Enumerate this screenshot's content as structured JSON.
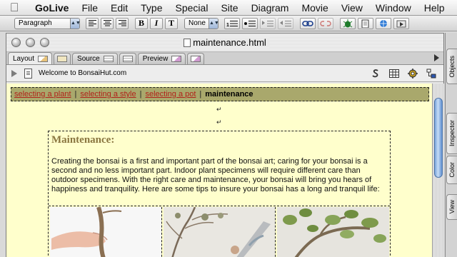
{
  "menubar": {
    "items": [
      "GoLive",
      "File",
      "Edit",
      "Type",
      "Special",
      "Site",
      "Diagram",
      "Movie",
      "View",
      "Window",
      "Help"
    ]
  },
  "toolbar": {
    "paragraph_format": "Paragraph",
    "font_size": "None",
    "bold_label": "B",
    "italic_label": "I",
    "teletype_label": "T"
  },
  "document": {
    "filename": "maintenance.html",
    "tabs": [
      "Layout",
      "Source",
      "Preview"
    ],
    "page_title": "Welcome to BonsaiHut.com"
  },
  "page": {
    "nav": {
      "links": [
        "selecting a plant",
        "selecting a style",
        "selecting a pot"
      ],
      "current": "maintenance"
    },
    "heading": "Maintenance:",
    "body": "Creating the bonsai is a first and important part of the bonsai art; caring for your bonsai is a second and no less important part. Indoor plant specimens will require different care than outdoor specimens. With the right care and maintenance, your bonsai will bring you hears of happiness and tranquility. Here are some tips to insure your bonsai has a long and tranquil life:"
  },
  "palette": {
    "tabs": [
      "Objects",
      "Inspector",
      "Color",
      "View"
    ]
  },
  "colors": {
    "page_background": "#ffffcc",
    "nav_background": "#a9a86c",
    "link": "#b1221a",
    "heading": "#8a7640"
  }
}
